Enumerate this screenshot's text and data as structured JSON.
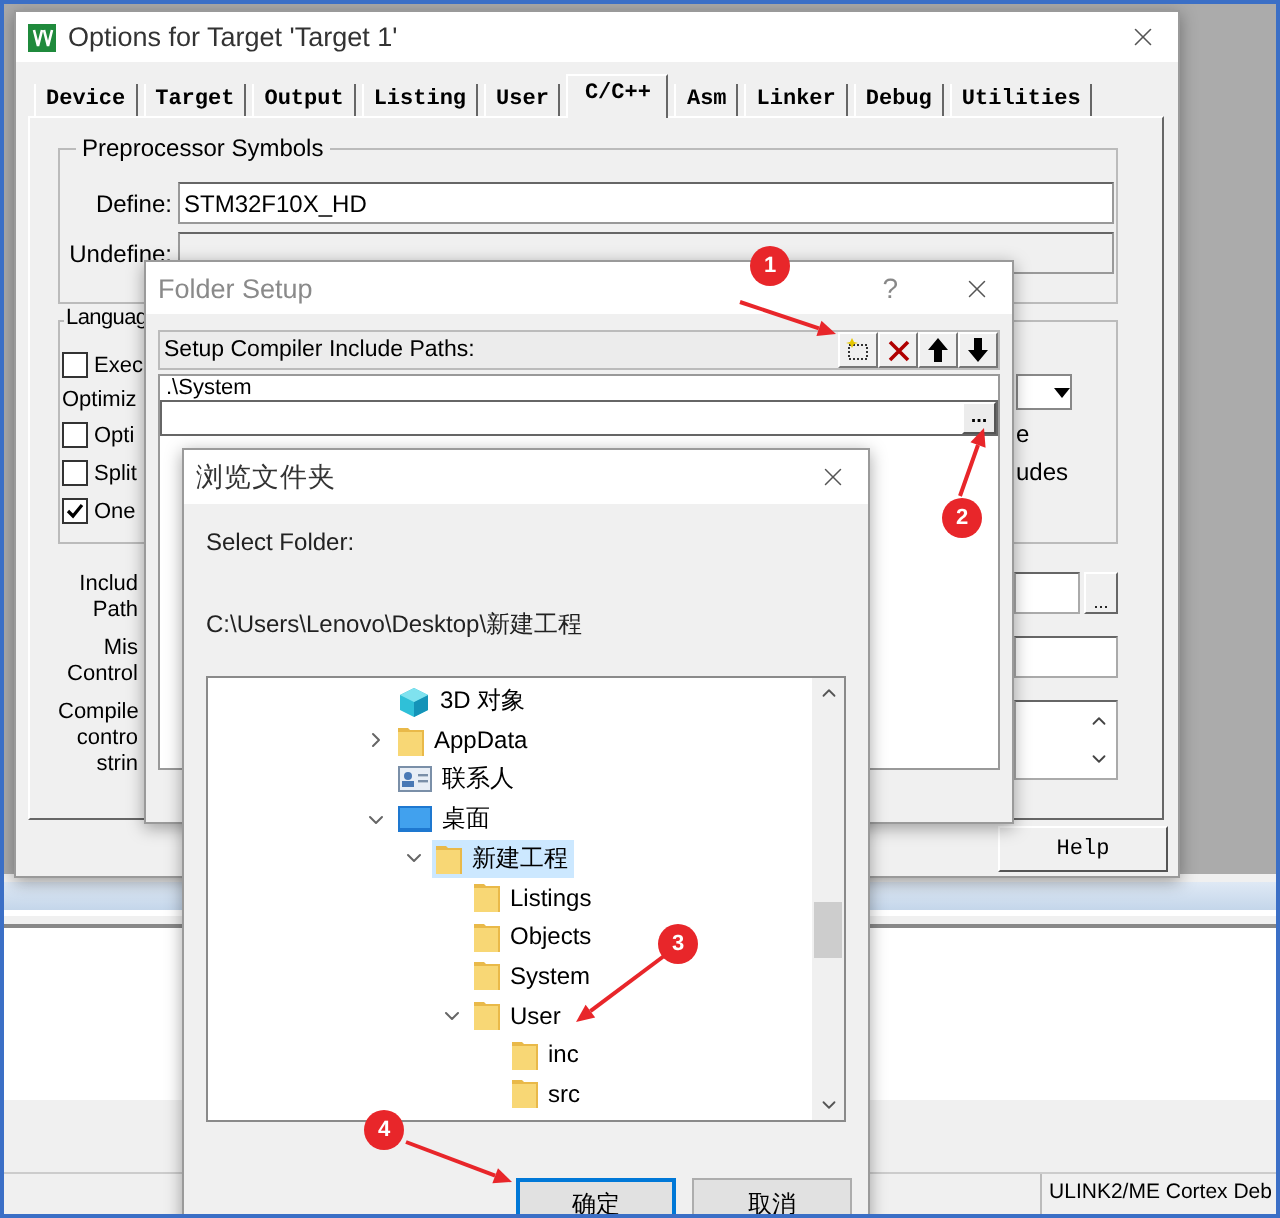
{
  "ide": {
    "status_text": "ULINK2/ME Cortex Deb"
  },
  "options_window": {
    "title": "Options for Target 'Target 1'",
    "tabs": [
      {
        "label": "Device",
        "selected": false
      },
      {
        "label": "Target",
        "selected": false
      },
      {
        "label": "Output",
        "selected": false
      },
      {
        "label": "Listing",
        "selected": false
      },
      {
        "label": "User",
        "selected": false
      },
      {
        "label": "C/C++",
        "selected": true
      },
      {
        "label": "Asm",
        "selected": false
      },
      {
        "label": "Linker",
        "selected": false
      },
      {
        "label": "Debug",
        "selected": false
      },
      {
        "label": "Utilities",
        "selected": false
      }
    ],
    "preprocessor": {
      "title": "Preprocessor Symbols",
      "define_label": "Define:",
      "define_value": "STM32F10X_HD",
      "undefine_label": "Undefine:"
    },
    "language": {
      "title": "Languag",
      "optimization_label": "Optimiz",
      "right_fragments": [
        "e",
        "udes"
      ],
      "top_options": [
        {
          "label": "Exec",
          "checked": false
        }
      ],
      "bottom_options": [
        {
          "label": "Opti",
          "checked": false
        },
        {
          "label": "Split",
          "checked": false
        },
        {
          "label": "One",
          "checked": true
        }
      ]
    },
    "include_paths_label": [
      "Includ",
      "Path"
    ],
    "misc_controls_label": [
      "Mis",
      "Control"
    ],
    "compiler_string_label": [
      "Compile",
      "contro",
      "strin"
    ],
    "browse_button": "...",
    "help_button": "Help"
  },
  "folder_setup": {
    "title": "Folder Setup",
    "help": "?",
    "header": "Setup Compiler Include Paths:",
    "paths": [
      ".\\System"
    ],
    "browse_button": "..."
  },
  "browse_dialog": {
    "title": "浏览文件夹",
    "prompt": "Select Folder:",
    "path": "C:\\Users\\Lenovo\\Desktop\\新建工程",
    "tree": [
      {
        "label": "3D 对象",
        "kind": "object3d",
        "selected": false
      },
      {
        "label": "AppData",
        "kind": "folder",
        "expanded": false,
        "selected": false
      },
      {
        "label": "联系人",
        "kind": "contacts",
        "selected": false
      },
      {
        "label": "桌面",
        "kind": "desktop",
        "expanded": true,
        "selected": false,
        "children": [
          {
            "label": "新建工程",
            "kind": "folder",
            "expanded": true,
            "selected": true,
            "children": [
              {
                "label": "Listings",
                "kind": "folder",
                "selected": false
              },
              {
                "label": "Objects",
                "kind": "folder",
                "selected": false
              },
              {
                "label": "System",
                "kind": "folder",
                "selected": false
              },
              {
                "label": "User",
                "kind": "folder",
                "expanded": true,
                "selected": false,
                "children": [
                  {
                    "label": "inc",
                    "kind": "folder",
                    "selected": false
                  },
                  {
                    "label": "src",
                    "kind": "folder",
                    "selected": false
                  }
                ]
              }
            ]
          }
        ]
      }
    ],
    "buttons": [
      {
        "label": "确定",
        "focused": true
      },
      {
        "label": "取消",
        "focused": false
      }
    ]
  },
  "annotations": [
    {
      "label": "1"
    },
    {
      "label": "2"
    },
    {
      "label": "3"
    },
    {
      "label": "4"
    }
  ]
}
